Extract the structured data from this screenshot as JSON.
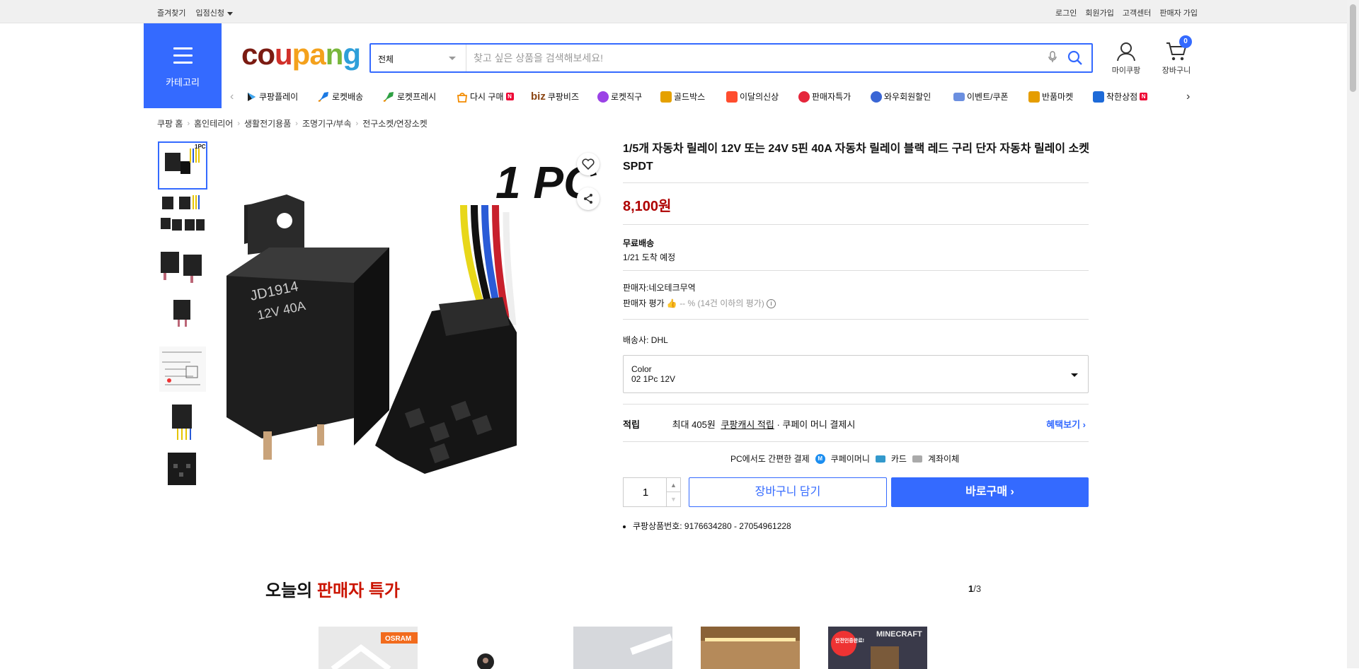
{
  "topbar": {
    "bookmark": "즐겨찾기",
    "apply": "입점신청",
    "login": "로그인",
    "signup": "회원가입",
    "support": "고객센터",
    "seller_signup": "판매자 가입"
  },
  "header": {
    "category_label": "카테고리",
    "logo": {
      "c1": "co",
      "c2": "u",
      "c3": "pa",
      "c4": "n",
      "c5": "g"
    },
    "search_category": "전체",
    "search_placeholder": "찾고 싶은 상품을 검색해보세요!",
    "mycoupang": "마이쿠팡",
    "cart": "장바구니",
    "cart_count": "0"
  },
  "nav": {
    "items": [
      {
        "label": "쿠팡플레이",
        "icon": "play-icon",
        "color": "#333"
      },
      {
        "label": "로켓배송",
        "icon": "rocket-icon",
        "color": "#1b7ae3"
      },
      {
        "label": "로켓프레시",
        "icon": "rocket-fresh-icon",
        "color": "#2ea043"
      },
      {
        "label": "다시 구매",
        "icon": "rebuy-icon",
        "color": "#f28b00"
      },
      {
        "label": "쿠팡비즈",
        "icon": "biz-icon",
        "color": "#8b4513"
      },
      {
        "label": "로켓직구",
        "icon": "global-rocket-icon",
        "color": "#9b42e6"
      },
      {
        "label": "골드박스",
        "icon": "goldbox-icon",
        "color": "#e5a100"
      },
      {
        "label": "이달의신상",
        "icon": "new-icon",
        "color": "#ff4d2e"
      },
      {
        "label": "판매자특가",
        "icon": "seller-deal-icon",
        "color": "#e5263b"
      },
      {
        "label": "와우회원할인",
        "icon": "wow-icon",
        "color": "#3a66d5"
      },
      {
        "label": "이벤트/쿠폰",
        "icon": "event-icon",
        "color": "#3a66d5"
      },
      {
        "label": "반품마켓",
        "icon": "return-market-icon",
        "color": "#e59d00"
      },
      {
        "label": "착한상점",
        "icon": "good-store-icon",
        "color": "#1d6ad8"
      }
    ],
    "biz_prefix": "biz",
    "new_badge": "N"
  },
  "breadcrumb": [
    "쿠팡 홈",
    "홈인테리어",
    "생활전기용품",
    "조명기구/부속",
    "전구소켓/연장소켓"
  ],
  "product": {
    "image_label": "1 PC",
    "relay_text": [
      "JD1914",
      "12V  40A"
    ],
    "title": "1/5개 자동차 릴레이 12V 또는 24V 5핀 40A 자동차 릴레이 블랙 레드 구리 단자 자동차 릴레이 소켓 SPDT",
    "price": "8,100원",
    "shipping_free": "무료배송",
    "arrival": "1/21 도착 예정",
    "seller": "판매자:네오테크무역",
    "seller_rating_label": "판매자 평가",
    "seller_rating_value": "-- % (14건 이하의 평가)",
    "carrier": "배송사:  DHL",
    "option_name": "Color",
    "option_value": "02 1Pc 12V",
    "reward_label": "적립",
    "reward_text_1": "최대 405원",
    "reward_link": "쿠팡캐시 적립",
    "reward_text_2": "· 쿠페이 머니 결제시",
    "benefit_link": "혜택보기",
    "pay_intro": "PC에서도 간편한 결제",
    "pay_coupay": "쿠페이머니",
    "pay_card": "카드",
    "pay_bank": "계좌이체",
    "quantity": "1",
    "add_to_cart": "장바구니 담기",
    "buy_now": "바로구매",
    "product_number": "쿠팡상품번호: 9176634280 - 27054961228"
  },
  "deals": {
    "title_1": "오늘의",
    "title_2": "판매자 특가",
    "page_current": "1",
    "page_total": "/3",
    "card1_brand": "OSRAM",
    "card5_badge": "안전인증완료!",
    "card5_brand": "MINECRAFT"
  }
}
